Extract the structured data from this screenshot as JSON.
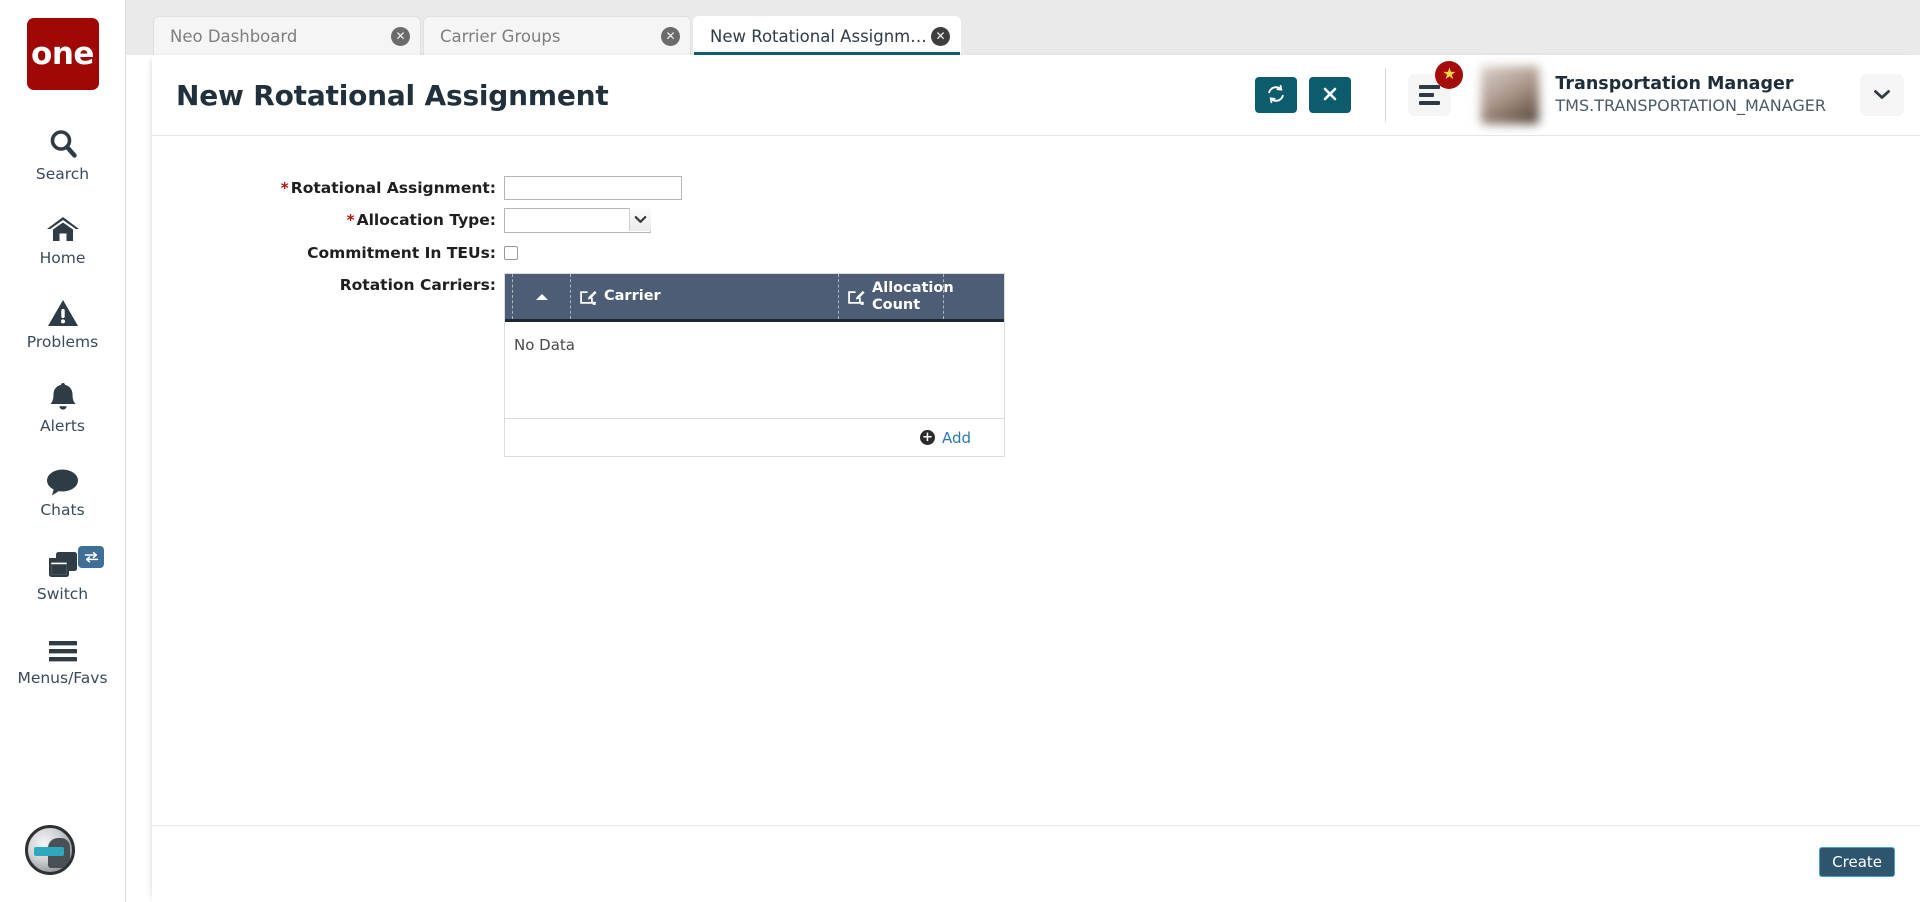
{
  "app": {
    "logo_text": "one",
    "assistant_icon": "ai-assistant-avatar-icon"
  },
  "sidebar": {
    "items": [
      {
        "label": "Search",
        "icon": "search-icon"
      },
      {
        "label": "Home",
        "icon": "home-icon"
      },
      {
        "label": "Problems",
        "icon": "warning-triangle-icon"
      },
      {
        "label": "Alerts",
        "icon": "bell-icon"
      },
      {
        "label": "Chats",
        "icon": "chat-bubble-icon"
      },
      {
        "label": "Switch",
        "icon": "windows-stack-icon",
        "badge_icon": "swap-arrows-icon"
      },
      {
        "label": "Menus/Favs",
        "icon": "hamburger-icon"
      }
    ]
  },
  "tabs": [
    {
      "label": "Neo Dashboard",
      "active": false,
      "close_icon": "close-circle-icon"
    },
    {
      "label": "Carrier Groups",
      "active": false,
      "close_icon": "close-circle-icon"
    },
    {
      "label": "New Rotational Assignment",
      "active": true,
      "close_icon": "close-circle-icon"
    }
  ],
  "header": {
    "title": "New Rotational Assignment",
    "refresh_icon": "refresh-sync-icon",
    "close_icon": "close-x-icon",
    "menu_icon": "list-menu-icon",
    "star_badge_icon": "star-icon",
    "star_badge_glyph": "★",
    "caret_icon": "chevron-down-icon",
    "avatar_icon": "user-avatar",
    "user_name": "Transportation Manager",
    "user_id": "TMS.TRANSPORTATION_MANAGER"
  },
  "form": {
    "rotational_assignment": {
      "label": "Rotational Assignment:",
      "required": true,
      "required_mark": "*",
      "value": "",
      "placeholder": ""
    },
    "allocation_type": {
      "label": "Allocation Type:",
      "required": true,
      "required_mark": "*",
      "selected": "",
      "options": [
        ""
      ]
    },
    "commitment_in_teus": {
      "label": "Commitment In TEUs:",
      "required": false,
      "checked": false
    },
    "rotation_carriers": {
      "label": "Rotation Carriers:"
    }
  },
  "grid": {
    "columns": [
      {
        "key": "sort",
        "label": "",
        "icon": "sort-ascending-icon"
      },
      {
        "key": "carrier",
        "label": "Carrier",
        "icon": "edit-required-icon"
      },
      {
        "key": "alloc",
        "label": "Allocation Count",
        "icon": "edit-required-icon"
      }
    ],
    "rows": [],
    "empty_text": "No Data",
    "add_label": "Add",
    "add_icon": "plus-circle-icon"
  },
  "footer": {
    "create_label": "Create"
  },
  "colors": {
    "brand_red": "#a00806",
    "teal_button": "#0d5c6e",
    "active_tab_underline": "#11606e",
    "grid_header": "#4d5d75",
    "create_button": "#2d556e",
    "create_border": "#4aa3c7",
    "link_blue": "#2c7ab5",
    "required_red": "#b01515",
    "badge_red": "#a50d0d"
  }
}
